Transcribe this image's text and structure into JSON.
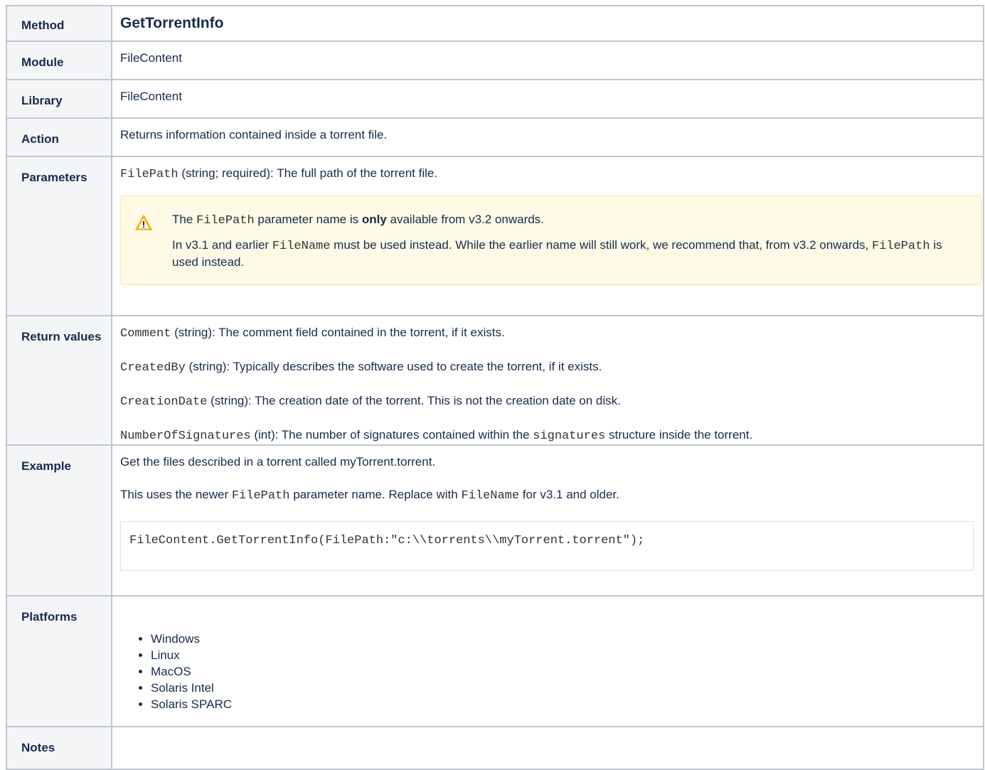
{
  "rows": {
    "method": {
      "key": "Method",
      "value": "GetTorrentInfo"
    },
    "module": {
      "key": "Module",
      "value": "FileContent"
    },
    "library": {
      "key": "Library",
      "value": "FileContent"
    },
    "action": {
      "key": "Action",
      "value": "Returns information contained inside a torrent file."
    },
    "parameters": {
      "key": "Parameters",
      "param_name": "FilePath",
      "param_desc": " (string; required): The full path of the torrent file.",
      "warning": {
        "icon": "warning-triangle-icon",
        "line1_pre": "The ",
        "line1_code": "FilePath",
        "line1_mid": " parameter name is ",
        "line1_bold": "only",
        "line1_post": " available from v3.2 onwards.",
        "line2_pre": "In v3.1 and earlier ",
        "line2_code1": "FileName",
        "line2_mid": " must be used instead.  While the earlier name will still work, we recommend that, from v3.2 onwards, ",
        "line2_code2": "FilePath",
        "line2_post": " is used instead."
      }
    },
    "return_values": {
      "key": "Return values",
      "items": [
        {
          "code": "Comment",
          "text": " (string): The comment field contained in the torrent, if it exists."
        },
        {
          "code": "CreatedBy",
          "text": " (string): Typically describes the software used to create the torrent, if it exists."
        },
        {
          "code": "CreationDate",
          "text": " (string): The creation date of the torrent. This is not the creation date on disk."
        },
        {
          "code": "NumberOfSignatures",
          "text": " (int): The number of signatures contained within the ",
          "code2": "signatures",
          "text2": " structure inside the torrent."
        }
      ]
    },
    "example": {
      "key": "Example",
      "line1": "Get the files described in a torrent called myTorrent.torrent.",
      "line2_pre": "This uses the newer ",
      "line2_code1": "FilePath",
      "line2_mid": " parameter name. Replace with ",
      "line2_code2": "FileName",
      "line2_post": " for v3.1 and older.",
      "code": "FileContent.GetTorrentInfo(FilePath:\"c:\\\\torrents\\\\myTorrent.torrent\");"
    },
    "platforms": {
      "key": "Platforms",
      "items": [
        "Windows",
        "Linux",
        "MacOS",
        "Solaris Intel",
        "Solaris SPARC"
      ]
    },
    "notes": {
      "key": "Notes",
      "value": ""
    }
  }
}
